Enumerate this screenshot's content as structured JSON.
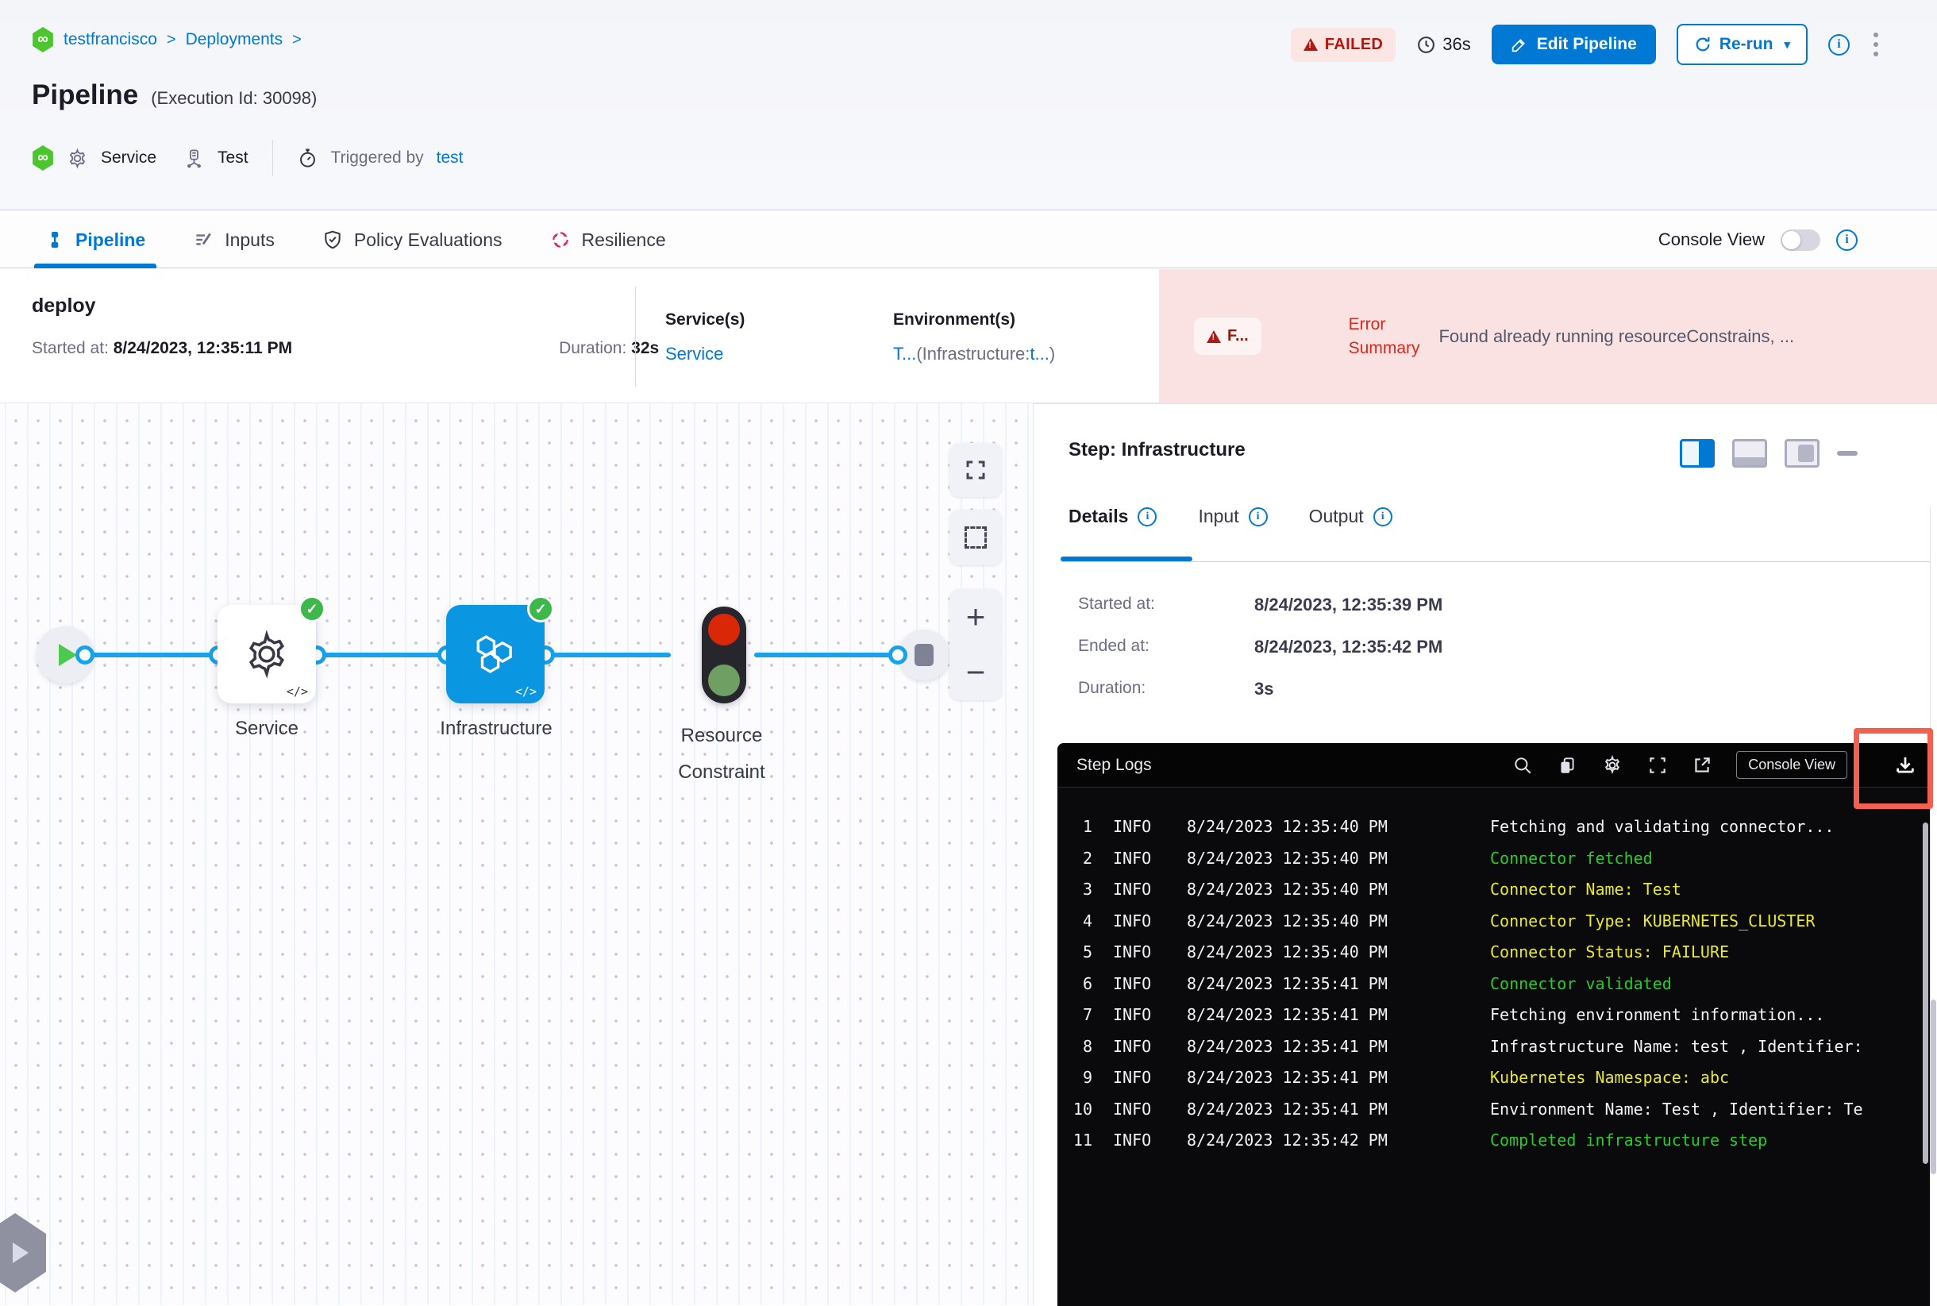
{
  "colors": {
    "primary": "#0278d5",
    "success": "#3eb84a",
    "failed_text": "#b41710",
    "error_bg": "#f9e2e1",
    "log_green": "#27cd27",
    "log_yellow": "#e9e92a"
  },
  "breadcrumb": {
    "project": "testfrancisco",
    "section": "Deployments",
    "sep": ">"
  },
  "header": {
    "title": "Pipeline",
    "execution_id": "(Execution Id: 30098)",
    "service_label": "Service",
    "environment_label": "Test",
    "triggered_by_label": "Triggered by",
    "triggered_by_value": "test",
    "status_badge": "FAILED",
    "elapsed": "36s",
    "edit_pipeline_label": "Edit Pipeline",
    "rerun_label": "Re-run"
  },
  "tabs": [
    {
      "label": "Pipeline"
    },
    {
      "label": "Inputs"
    },
    {
      "label": "Policy Evaluations"
    },
    {
      "label": "Resilience"
    }
  ],
  "console_view_label": "Console View",
  "stage": {
    "name": "deploy",
    "started_label": "Started at:",
    "started_value": "8/24/2023, 12:35:11 PM",
    "duration_label": "Duration:",
    "duration_value": "32s",
    "services_label": "Service(s)",
    "service_value": "Service",
    "environments_label": "Environment(s)",
    "env_link_1": "T...",
    "env_mid": "(Infrastructure:",
    "env_link_2": "t...",
    "env_close": ")",
    "error_badge": "F...",
    "error_label": "Error Summary",
    "error_message": "Found already running resourceConstrains, ..."
  },
  "graph": {
    "nodes": [
      {
        "label": "Service"
      },
      {
        "label": "Infrastructure"
      },
      {
        "label": "Resource Constraint"
      }
    ],
    "code_tag": "</>"
  },
  "panel": {
    "title": "Step: Infrastructure",
    "tabs": [
      {
        "label": "Details"
      },
      {
        "label": "Input"
      },
      {
        "label": "Output"
      }
    ],
    "details": {
      "rows": [
        {
          "label": "Started at:",
          "value": "8/24/2023, 12:35:39 PM"
        },
        {
          "label": "Ended at:",
          "value": "8/24/2023, 12:35:42 PM"
        },
        {
          "label": "Duration:",
          "value": "3s"
        }
      ]
    }
  },
  "logs": {
    "title": "Step Logs",
    "console_view_button": "Console View",
    "lines": [
      {
        "num": "1",
        "level": "INFO",
        "time": "8/24/2023 12:35:40 PM",
        "message": "Fetching and validating connector...",
        "color": "white"
      },
      {
        "num": "2",
        "level": "INFO",
        "time": "8/24/2023 12:35:40 PM",
        "message": "Connector fetched",
        "color": "green"
      },
      {
        "num": "3",
        "level": "INFO",
        "time": "8/24/2023 12:35:40 PM",
        "message": "Connector Name: Test",
        "color": "yellow"
      },
      {
        "num": "4",
        "level": "INFO",
        "time": "8/24/2023 12:35:40 PM",
        "message": "Connector Type: KUBERNETES_CLUSTER",
        "color": "yellow"
      },
      {
        "num": "5",
        "level": "INFO",
        "time": "8/24/2023 12:35:40 PM",
        "message": "Connector Status: FAILURE",
        "color": "yellow"
      },
      {
        "num": "6",
        "level": "INFO",
        "time": "8/24/2023 12:35:41 PM",
        "message": "Connector validated",
        "color": "green"
      },
      {
        "num": "7",
        "level": "INFO",
        "time": "8/24/2023 12:35:41 PM",
        "message": "Fetching environment information...",
        "color": "white"
      },
      {
        "num": "8",
        "level": "INFO",
        "time": "8/24/2023 12:35:41 PM",
        "message": "Infrastructure Name: test , Identifier:",
        "color": "white"
      },
      {
        "num": "9",
        "level": "INFO",
        "time": "8/24/2023 12:35:41 PM",
        "message": "Kubernetes Namespace: abc",
        "color": "yellow"
      },
      {
        "num": "10",
        "level": "INFO",
        "time": "8/24/2023 12:35:41 PM",
        "message": "Environment Name: Test , Identifier: Te",
        "color": "white"
      },
      {
        "num": "11",
        "level": "INFO",
        "time": "8/24/2023 12:35:42 PM",
        "message": "Completed infrastructure step",
        "color": "green"
      }
    ]
  }
}
